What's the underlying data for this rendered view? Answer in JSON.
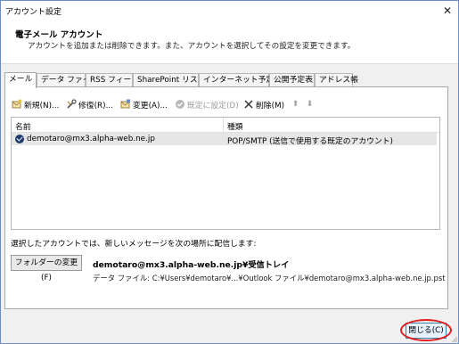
{
  "window": {
    "title": "アカウント設定",
    "close_symbol": "✕"
  },
  "header": {
    "title": "電子メール アカウント",
    "description": "アカウントを追加または削除できます。また、アカウントを選択してその設定を変更できます。"
  },
  "tabs": [
    {
      "label": "メール",
      "active": true
    },
    {
      "label": "データ ファイル"
    },
    {
      "label": "RSS フィード"
    },
    {
      "label": "SharePoint リスト"
    },
    {
      "label": "インターネット予定表"
    },
    {
      "label": "公開予定表"
    },
    {
      "label": "アドレス帳"
    }
  ],
  "toolbar": {
    "new_label": "新規(N)...",
    "repair_label": "修復(R)...",
    "change_label": "変更(A)...",
    "default_label": "既定に設定(D)",
    "delete_label": "削除(M)",
    "up_symbol": "⬆",
    "down_symbol": "⬇"
  },
  "accounts_table": {
    "columns": [
      "名前",
      "種類"
    ],
    "rows": [
      {
        "name": "demotaro@mx3.alpha-web.ne.jp",
        "type": "POP/SMTP (送信で使用する既定のアカウント)"
      }
    ]
  },
  "delivery": {
    "text": "選択したアカウントでは、新しいメッセージを次の場所に配信します:",
    "change_folder_label": "フォルダーの変更(F)",
    "folder_path": "demotaro@mx3.alpha-web.ne.jp¥受信トレイ",
    "data_file": "データ ファイル: C:¥Users¥demotaro¥...¥Outlook ファイル¥demotaro@mx3.alpha-web.ne.jp.pst"
  },
  "footer": {
    "close_label": "閉じる(C)"
  }
}
